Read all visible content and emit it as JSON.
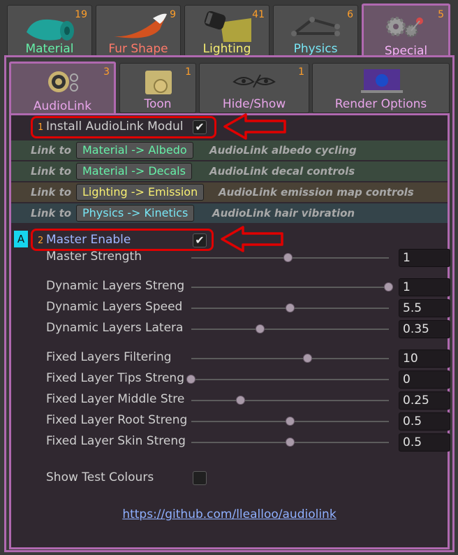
{
  "top_tabs": [
    {
      "label": "Material",
      "count": "19",
      "color": "#66f0a8",
      "icon": "material-icon"
    },
    {
      "label": "Fur Shape",
      "count": "9",
      "color": "#ff7a6a",
      "icon": "fur-shape-icon"
    },
    {
      "label": "Lighting",
      "count": "41",
      "color": "#f7ef72",
      "icon": "lighting-icon"
    },
    {
      "label": "Physics",
      "count": "6",
      "color": "#78e6f5",
      "icon": "physics-icon"
    },
    {
      "label": "Special",
      "count": "5",
      "color": "#f6b2f8",
      "icon": "special-gears-icon"
    }
  ],
  "sub_tabs": [
    {
      "label": "AudioLink",
      "count": "3",
      "icon": "audiolink-speaker-icon"
    },
    {
      "label": "Toon",
      "count": "1",
      "icon": "toon-icon"
    },
    {
      "label": "Hide/Show",
      "count": "1",
      "icon": "hide-show-eye-icon"
    },
    {
      "label": "Render Options",
      "count": "",
      "icon": "render-options-icon"
    }
  ],
  "install": {
    "marker": "1",
    "label": "Install AudioLink Modul",
    "checked": true
  },
  "links": {
    "link_to": "Link to",
    "rows": [
      {
        "button": "Material -> Albedo",
        "desc": "AudioLink albedo cycling",
        "color": "#66f0a8"
      },
      {
        "button": "Material -> Decals",
        "desc": "AudioLink decal controls",
        "color": "#66f0a8"
      },
      {
        "button": "Lighting -> Emission",
        "desc": "AudioLink emission map controls",
        "color": "#f7ef72"
      },
      {
        "button": "Physics -> Kinetics",
        "desc": "AudioLink hair vibration",
        "color": "#78e6f5"
      }
    ]
  },
  "master": {
    "badge": "A",
    "marker": "2",
    "label": "Master Enable",
    "checked": true
  },
  "sliders": [
    {
      "label": "Master Strength",
      "value": "1",
      "fraction": 0.49
    },
    {
      "label": "Dynamic Layers Streng",
      "value": "1",
      "fraction": 1.0
    },
    {
      "label": "Dynamic Layers Speed",
      "value": "5.5",
      "fraction": 0.5
    },
    {
      "label": "Dynamic Layers Latera",
      "value": "0.35",
      "fraction": 0.35
    },
    {
      "label": "Fixed Layers Filtering",
      "value": "10",
      "fraction": 0.59
    },
    {
      "label": "Fixed Layer Tips Streng",
      "value": "0",
      "fraction": 0.0
    },
    {
      "label": "Fixed Layer Middle Stre",
      "value": "0.25",
      "fraction": 0.25
    },
    {
      "label": "Fixed Layer Root Streng",
      "value": "0.5",
      "fraction": 0.5
    },
    {
      "label": "Fixed Layer Skin Streng",
      "value": "0.5",
      "fraction": 0.5
    }
  ],
  "show_test": {
    "label": "Show Test Colours",
    "checked": false
  },
  "footer_link": "https://github.com/llealloo/audiolink"
}
